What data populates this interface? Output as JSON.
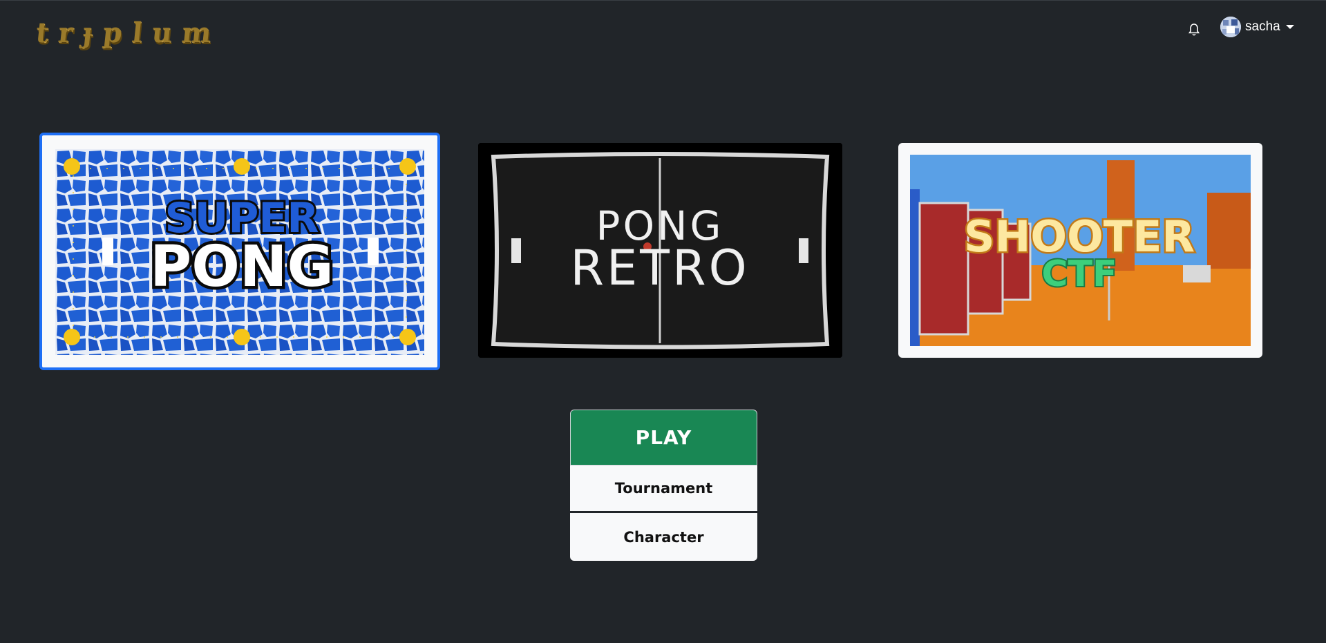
{
  "header": {
    "logo_text": "trɟplum",
    "notifications_icon": "bell-icon",
    "user": {
      "name": "sacha",
      "avatar_icon": "avatar-icon",
      "menu_icon": "caret-down-icon"
    }
  },
  "games": [
    {
      "id": "super-pong",
      "title_top": "SUPER",
      "title_bottom": "PONG",
      "selected": true,
      "accent": "#1e6ff5"
    },
    {
      "id": "pong-retro",
      "title_top": "PONG",
      "title_bottom": "RETRO",
      "selected": false
    },
    {
      "id": "shooter-ctf",
      "title_top": "SHOOTER",
      "title_bottom": "CTF",
      "selected": false
    }
  ],
  "actions": {
    "play_label": "PLAY",
    "tournament_label": "Tournament",
    "character_label": "Character"
  },
  "colors": {
    "background": "#212529",
    "play": "#198754",
    "selected_border": "#1e6ff5",
    "light_button": "#f8f9fa"
  }
}
